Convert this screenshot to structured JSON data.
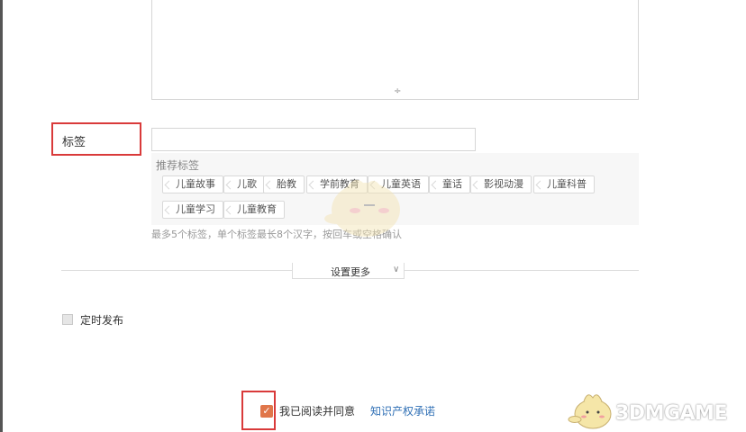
{
  "description_box": {
    "resize_glyph": "÷"
  },
  "tags": {
    "label": "标签",
    "input_value": "",
    "recommended": {
      "title": "推荐标签",
      "chips": [
        "儿童故事",
        "儿歌",
        "胎教",
        "学前教育",
        "儿童英语",
        "童话",
        "影视动漫",
        "儿童科普",
        "儿童学习",
        "儿童教育"
      ]
    },
    "hint": "最多5个标签，单个标签最长8个汉字，按回车或空格确认"
  },
  "more_settings": {
    "label": "设置更多",
    "chevron": "∨"
  },
  "scheduled": {
    "label": "定时发布",
    "checked": false
  },
  "agreement": {
    "text": "我已阅读并同意",
    "link": "知识产权承诺",
    "checked": true,
    "check_glyph": "✓"
  },
  "watermark": {
    "text": "3DMGAME"
  },
  "colors": {
    "accent": "#e0764a",
    "highlight_red": "#d93a3a",
    "link": "#2f6fb5"
  }
}
